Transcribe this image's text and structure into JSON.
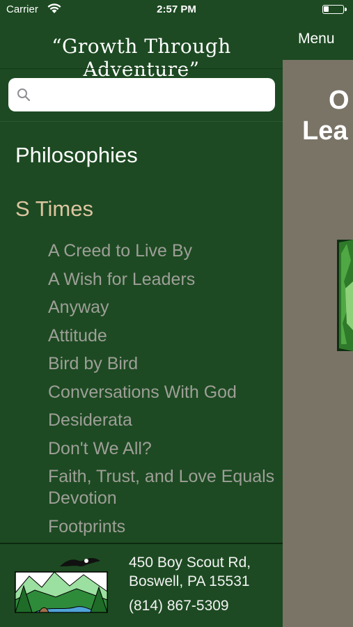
{
  "status_bar": {
    "carrier": "Carrier",
    "time": "2:57 PM"
  },
  "drawer": {
    "title": "“Growth Through Adventure”",
    "search": {
      "placeholder": "",
      "value": ""
    },
    "sections": [
      {
        "title": "Philosophies",
        "color": "#ffffff"
      },
      {
        "title": "S Times",
        "color": "#dcc5a1"
      }
    ],
    "items": [
      "A Creed to Live By",
      "A Wish for Leaders",
      "Anyway",
      "Attitude",
      "Bird by Bird",
      "Conversations With God",
      "Desiderata",
      "Don't We All?",
      "Faith, Trust, and Love Equals Devotion",
      "Footprints"
    ],
    "footer": {
      "address_line1": "450 Boy Scout Rd,",
      "address_line2": "Boswell, PA 15531",
      "phone": "(814) 867-5309"
    }
  },
  "behind": {
    "menu_label": "Menu",
    "title_line1": "O",
    "title_line2": "Lea"
  },
  "colors": {
    "background": "#1d4a22",
    "content_bg": "#7a7467",
    "item_text": "#9e9f98",
    "active_section": "#dcc5a1"
  }
}
